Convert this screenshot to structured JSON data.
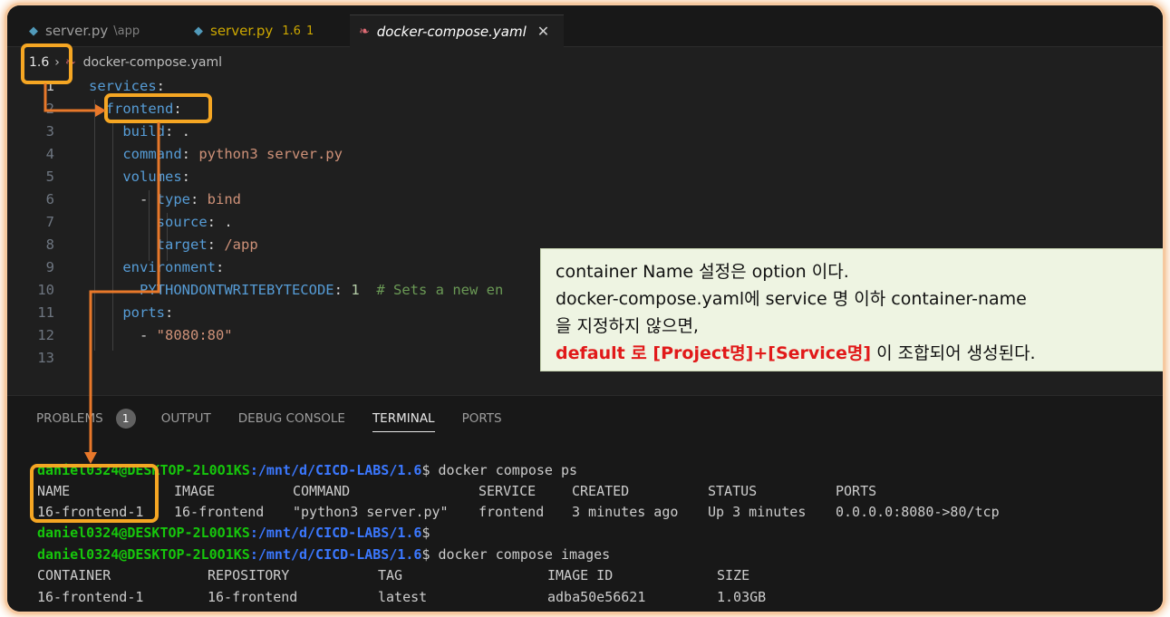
{
  "tabs": [
    {
      "name": "server.py",
      "suffix": "\\app"
    },
    {
      "name": "server.py",
      "badge_version": "1.6",
      "badge_count": "1"
    },
    {
      "name": "docker-compose.yaml",
      "close": "✕"
    }
  ],
  "breadcrumb": {
    "folder": "1.6",
    "separator": "›",
    "file": "docker-compose.yaml"
  },
  "editor": {
    "lines": [
      {
        "n": "1",
        "parts": [
          [
            "k",
            "services"
          ],
          [
            "pl",
            ":"
          ]
        ]
      },
      {
        "n": "2",
        "parts": [
          [
            "pl",
            "  "
          ],
          [
            "k",
            "frontend"
          ],
          [
            "pl",
            ":"
          ]
        ]
      },
      {
        "n": "3",
        "parts": [
          [
            "pl",
            "    "
          ],
          [
            "k",
            "build"
          ],
          [
            "pl",
            ": ."
          ]
        ]
      },
      {
        "n": "4",
        "parts": [
          [
            "pl",
            "    "
          ],
          [
            "k",
            "command"
          ],
          [
            "pl",
            ": "
          ],
          [
            "s",
            "python3 server.py"
          ]
        ]
      },
      {
        "n": "5",
        "parts": [
          [
            "pl",
            "    "
          ],
          [
            "k",
            "volumes"
          ],
          [
            "pl",
            ":"
          ]
        ]
      },
      {
        "n": "6",
        "parts": [
          [
            "pl",
            "      - "
          ],
          [
            "k",
            "type"
          ],
          [
            "pl",
            ": "
          ],
          [
            "s",
            "bind"
          ]
        ]
      },
      {
        "n": "7",
        "parts": [
          [
            "pl",
            "        "
          ],
          [
            "k",
            "source"
          ],
          [
            "pl",
            ": ."
          ]
        ]
      },
      {
        "n": "8",
        "parts": [
          [
            "pl",
            "        "
          ],
          [
            "k",
            "target"
          ],
          [
            "pl",
            ": "
          ],
          [
            "s",
            "/app"
          ]
        ]
      },
      {
        "n": "9",
        "parts": [
          [
            "pl",
            "    "
          ],
          [
            "k",
            "environment"
          ],
          [
            "pl",
            ":"
          ]
        ]
      },
      {
        "n": "10",
        "parts": [
          [
            "pl",
            "      "
          ],
          [
            "k",
            "PYTHONDONTWRITEBYTECODE"
          ],
          [
            "pl",
            ": "
          ],
          [
            "n",
            "1"
          ],
          [
            "pl",
            "  "
          ],
          [
            "cm",
            "# Sets a new en"
          ]
        ]
      },
      {
        "n": "11",
        "parts": [
          [
            "pl",
            "    "
          ],
          [
            "k",
            "ports"
          ],
          [
            "pl",
            ":"
          ]
        ]
      },
      {
        "n": "12",
        "parts": [
          [
            "pl",
            "      - "
          ],
          [
            "s",
            "\"8080:80\""
          ]
        ]
      },
      {
        "n": "13",
        "parts": []
      }
    ]
  },
  "callout": {
    "line1": "container Name 설정은 option 이다.",
    "line2": "docker-compose.yaml에 service 명 이하 container-name",
    "line3": "을 지정하지 않으면,",
    "line4_red": "default 로 [Project명]+[Service명]",
    "line4_rest": " 이 조합되어 생성된다."
  },
  "panel": {
    "tabs": [
      "PROBLEMS",
      "OUTPUT",
      "DEBUG CONSOLE",
      "TERMINAL",
      "PORTS"
    ],
    "problems_count": "1",
    "active_tab": "TERMINAL"
  },
  "terminal": {
    "user": "daniel0324@DESKTOP-2L0O1KS",
    "path": ":/mnt/d/CICD-LABS/1.6",
    "prompt_end": "$",
    "cmd_ps": " docker compose ps",
    "cmd_images": " docker compose images",
    "ps_headers": [
      "NAME",
      "IMAGE",
      "COMMAND",
      "SERVICE",
      "CREATED",
      "STATUS",
      "PORTS"
    ],
    "ps_row": [
      "16-frontend-1",
      "16-frontend",
      "\"python3 server.py\"",
      "frontend",
      "3 minutes ago",
      "Up 3 minutes",
      "0.0.0.0:8080->80/tcp"
    ],
    "img_headers": [
      "CONTAINER",
      "REPOSITORY",
      "TAG",
      "IMAGE ID",
      "SIZE"
    ],
    "img_row": [
      "16-frontend-1",
      "16-frontend",
      "latest",
      "adba50e56621",
      "1.03GB"
    ]
  },
  "colors": {
    "highlight": "#f5a623",
    "arrow": "#e8782a",
    "callout_red": "#e11919"
  }
}
